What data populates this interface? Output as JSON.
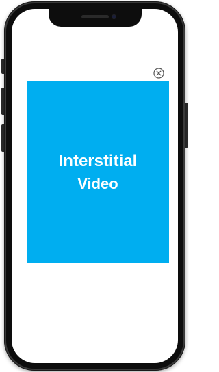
{
  "ad": {
    "title_line1": "Interstitial",
    "title_line2": "Video",
    "background_color": "#00aef0",
    "text_color": "#ffffff"
  },
  "close_button": {
    "icon": "close-circle-icon"
  },
  "device": {
    "frame_color": "#0d0d0d",
    "screen_color": "#ffffff"
  }
}
